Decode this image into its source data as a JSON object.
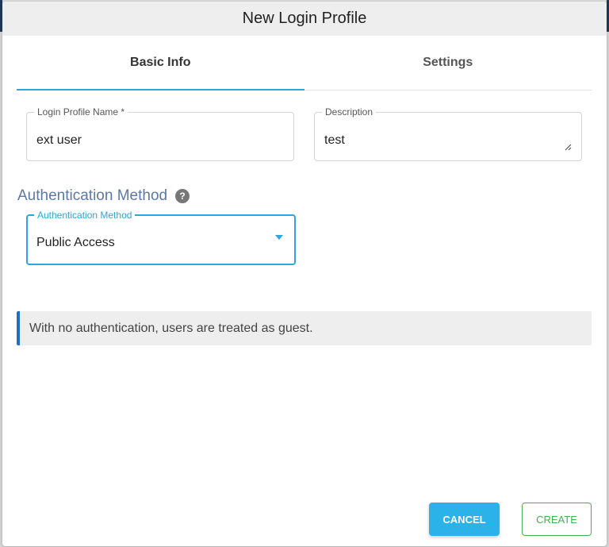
{
  "dialog": {
    "title": "New Login Profile"
  },
  "tabs": [
    {
      "label": "Basic Info",
      "active": true
    },
    {
      "label": "Settings",
      "active": false
    }
  ],
  "fields": {
    "login_profile_name": {
      "label": "Login Profile Name *",
      "value": "ext user"
    },
    "description": {
      "label": "Description",
      "value": "test"
    }
  },
  "auth": {
    "section_title": "Authentication Method",
    "select_label": "Authentication Method",
    "selected": "Public Access"
  },
  "info": {
    "message": "With no authentication, users are treated as guest."
  },
  "buttons": {
    "cancel": "CANCEL",
    "create": "CREATE"
  },
  "colors": {
    "accent": "#2aa7e0",
    "section_title": "#5b79a8",
    "info_border": "#1f6fc4",
    "create_green": "#3fb34f"
  },
  "icons": {
    "help": "question-circle-icon",
    "resize": "resize-handle-icon",
    "dropdown": "caret-down-icon"
  }
}
